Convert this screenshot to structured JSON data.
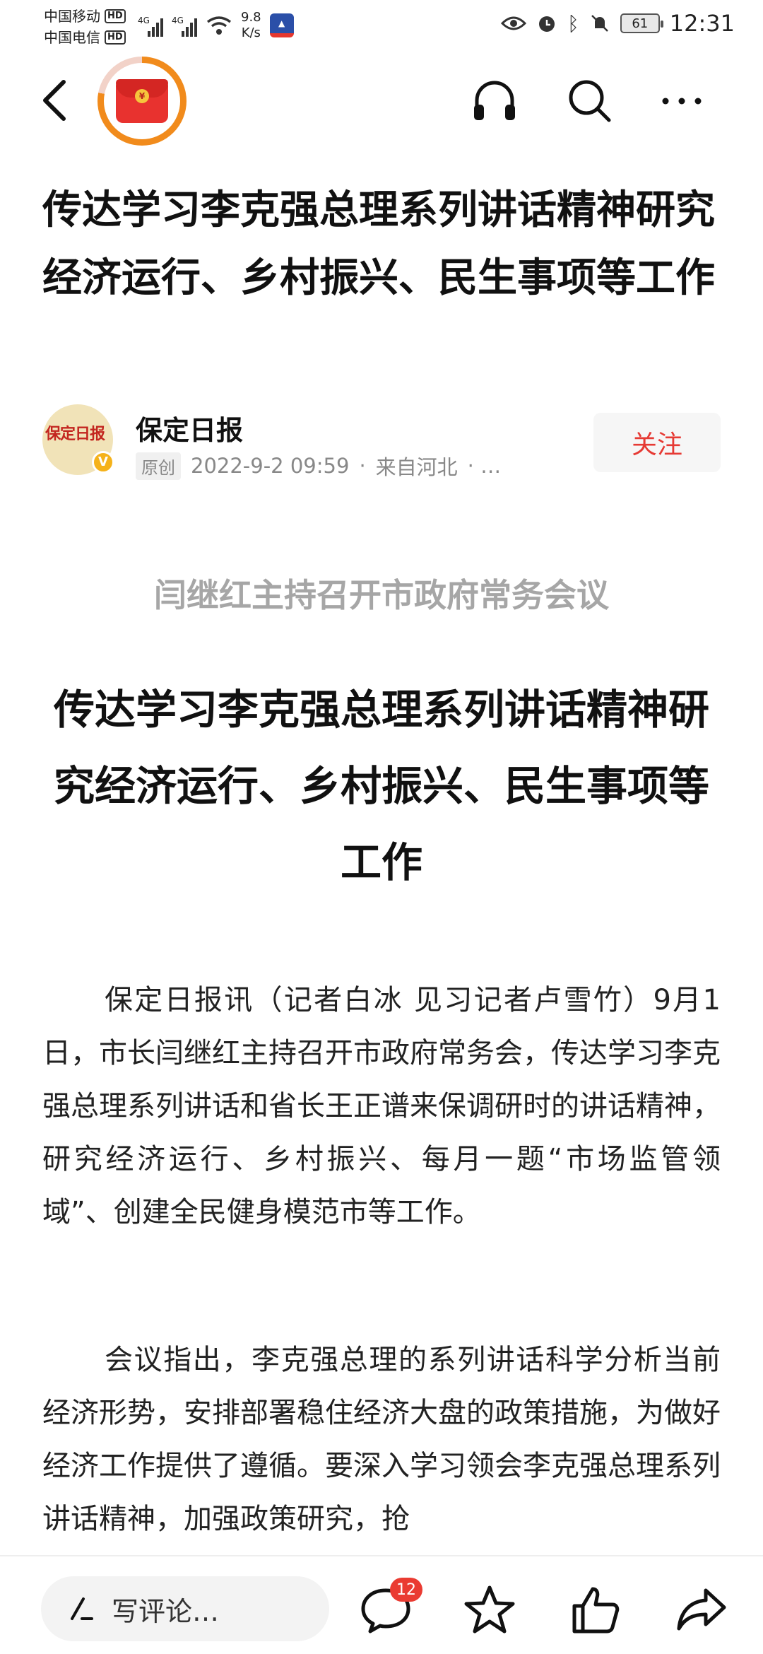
{
  "status_bar": {
    "carrier1": "中国移动",
    "carrier2": "中国电信",
    "hd": "HD",
    "network_label": "4G",
    "net_speed_value": "9.8",
    "net_speed_unit": "K/s",
    "battery": "61",
    "time": "12:31"
  },
  "top_nav": {
    "back_icon": "chevron-left-icon",
    "red_packet_icon": "red-packet-icon",
    "listen_icon": "headphones-icon",
    "search_icon": "search-icon",
    "more_icon": "more-dots-icon",
    "red_packet_progress": 0.78
  },
  "article": {
    "title": "传达学习李克强总理系列讲话精神研究经济运行、乡村振兴、民生事项等工作",
    "author": {
      "name": "保定日报",
      "logo_text": "保定日报",
      "verified_mark": "V",
      "original_badge": "原创",
      "datetime": "2022-9-2 09:59",
      "separator": "·",
      "location": "来自河北",
      "truncation": "·  …"
    },
    "follow_label": "关注",
    "subtitle": "闫继红主持召开市政府常务会议",
    "headline": "传达学习李克强总理系列讲话精神研究经济运行、乡村振兴、民生事项等工作",
    "paragraphs": [
      "保定日报讯（记者白冰 见习记者卢雪竹）9月1日，市长闫继红主持召开市政府常务会，传达学习李克强总理系列讲话和省长王正谱来保调研时的讲话精神，研究经济运行、乡村振兴、每月一题“市场监管领域”、创建全民健身模范市等工作。",
      "会议指出，李克强总理的系列讲话科学分析当前经济形势，安排部署稳住经济大盘的政策措施，为做好经济工作提供了遵循。要深入学习领会李克强总理系列讲话精神，加强政策研究，抢"
    ]
  },
  "bottom_bar": {
    "comment_placeholder": "写评论…",
    "comment_count": "12",
    "pen_icon": "pen-icon",
    "comments_icon": "comment-bubble-icon",
    "favorite_icon": "star-icon",
    "like_icon": "thumbs-up-icon",
    "share_icon": "share-arrow-icon"
  },
  "colors": {
    "accent_red": "#e63a34",
    "subtitle_gray": "#a6a6a6",
    "progress_orange": "#f18b1c"
  }
}
